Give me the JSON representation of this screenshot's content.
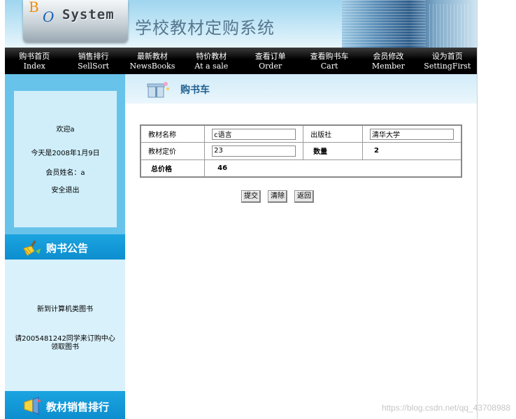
{
  "banner": {
    "logo_b": "B",
    "logo_o": "O",
    "logo_system": "System",
    "title": "学校教材定购系统"
  },
  "nav": [
    {
      "cn": "购书首页",
      "en": "Index"
    },
    {
      "cn": "销售排行",
      "en": "SellSort"
    },
    {
      "cn": "最新教材",
      "en": "NewsBooks"
    },
    {
      "cn": "特价教材",
      "en": "At a sale"
    },
    {
      "cn": "查看订单",
      "en": "Order"
    },
    {
      "cn": "查看购书车",
      "en": "Cart"
    },
    {
      "cn": "会员修改",
      "en": "Member"
    },
    {
      "cn": "设为首页",
      "en": "SettingFirst"
    }
  ],
  "welcome": {
    "greeting": "欢迎a",
    "date": "今天是2008年1月9日",
    "member": "会员姓名：a",
    "logout": "安全退出"
  },
  "notice": {
    "title": "购书公告",
    "line1": "新到计算机类图书",
    "line2": "请2005481242同学来订购中心",
    "line3": "领取图书"
  },
  "sales_rank": {
    "title": "教材销售排行"
  },
  "cart": {
    "title": "购书车",
    "name_label": "教材名称",
    "name_value": "c语言",
    "publisher_label": "出版社",
    "publisher_value": "清华大学",
    "price_label": "教材定价",
    "price_value": "23",
    "qty_label": "数量",
    "qty_value": "2",
    "total_label": "总价格",
    "total_value": "46"
  },
  "buttons": {
    "submit": "提交",
    "clear": "清除",
    "back": "返回"
  },
  "watermark": "https://blog.csdn.net/qq_43708988"
}
